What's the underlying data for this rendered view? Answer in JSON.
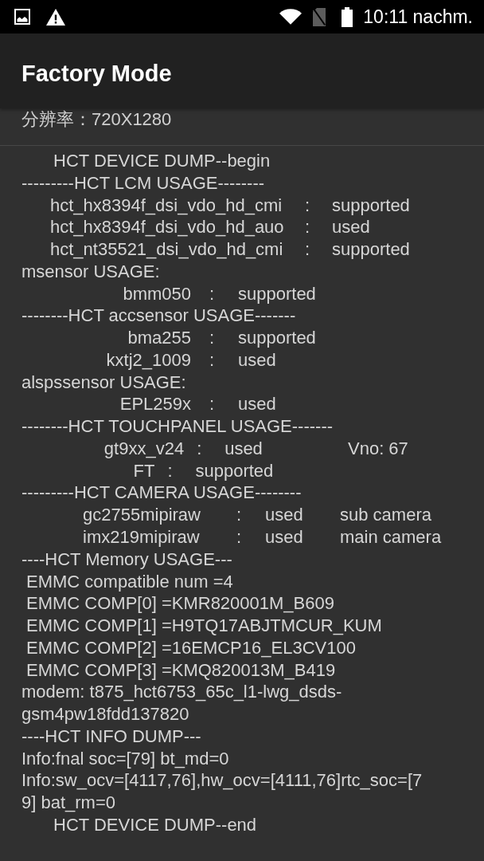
{
  "status_bar": {
    "time": "10:11 nachm."
  },
  "app_bar": {
    "title": "Factory Mode"
  },
  "info_lines": [
    "分辨率：720X1280"
  ],
  "dump": {
    "lines": [
      {
        "kind": "title",
        "text": "HCT DEVICE DUMP--begin"
      },
      {
        "kind": "text",
        "text": "---------HCT LCM USAGE--------"
      },
      {
        "kind": "lcm",
        "name": "hct_hx8394f_dsi_vdo_hd_cmi",
        "separator": ":",
        "value": "supported"
      },
      {
        "kind": "lcm",
        "name": "hct_hx8394f_dsi_vdo_hd_auo",
        "separator": ":",
        "value": "used"
      },
      {
        "kind": "lcm",
        "name": "hct_nt35521_dsi_vdo_hd_cmi",
        "separator": ":",
        "value": "supported"
      },
      {
        "kind": "text",
        "text": "msensor USAGE:"
      },
      {
        "kind": "sensor",
        "name": "bmm050",
        "separator": ":",
        "value": "supported"
      },
      {
        "kind": "text",
        "text": "--------HCT accsensor USAGE-------"
      },
      {
        "kind": "sensor",
        "name": "bma255",
        "separator": ":",
        "value": "supported"
      },
      {
        "kind": "sensor",
        "name": "kxtj2_1009",
        "separator": ":",
        "value": "used"
      },
      {
        "kind": "text",
        "text": "alspssensor USAGE:"
      },
      {
        "kind": "sensor",
        "name": "EPL259x",
        "separator": ":",
        "value": "used"
      },
      {
        "kind": "text",
        "text": "--------HCT TOUCHPANEL USAGE-------"
      },
      {
        "kind": "touch",
        "name": "gt9xx_v24",
        "separator": ":",
        "value": "used",
        "note": "Vno: 67"
      },
      {
        "kind": "touch",
        "name": "FT",
        "separator": ":",
        "value": "supported"
      },
      {
        "kind": "text",
        "text": "---------HCT CAMERA USAGE--------"
      },
      {
        "kind": "camera",
        "name": "gc2755mipiraw",
        "separator": ":",
        "value": "used",
        "note": "sub camera"
      },
      {
        "kind": "camera",
        "name": "imx219mipiraw",
        "separator": ":",
        "value": "used",
        "note": "main camera"
      },
      {
        "kind": "text",
        "text": "----HCT Memory USAGE---"
      },
      {
        "kind": "memory",
        "text": "EMMC compatible num =4"
      },
      {
        "kind": "memory",
        "text": "EMMC COMP[0] =KMR820001M_B609"
      },
      {
        "kind": "memory",
        "text": "EMMC COMP[1] =H9TQ17ABJTMCUR_KUM"
      },
      {
        "kind": "memory",
        "text": "EMMC COMP[2] =16EMCP16_EL3CV100"
      },
      {
        "kind": "memory",
        "text": "EMMC COMP[3] =KMQ820013M_B419"
      },
      {
        "kind": "text",
        "text": "modem: t875_hct6753_65c_l1-lwg_dsds-"
      },
      {
        "kind": "text",
        "text": "gsm4pw18fdd137820"
      },
      {
        "kind": "text",
        "text": "----HCT INFO DUMP---"
      },
      {
        "kind": "text",
        "text": "Info:fnal soc=[79] bt_md=0"
      },
      {
        "kind": "text",
        "text": "Info:sw_ocv=[4117,76],hw_ocv=[4111,76]rtc_soc=[7"
      },
      {
        "kind": "text",
        "text": "9] bat_rm=0"
      },
      {
        "kind": "title",
        "text": "HCT DEVICE DUMP--end"
      }
    ]
  }
}
